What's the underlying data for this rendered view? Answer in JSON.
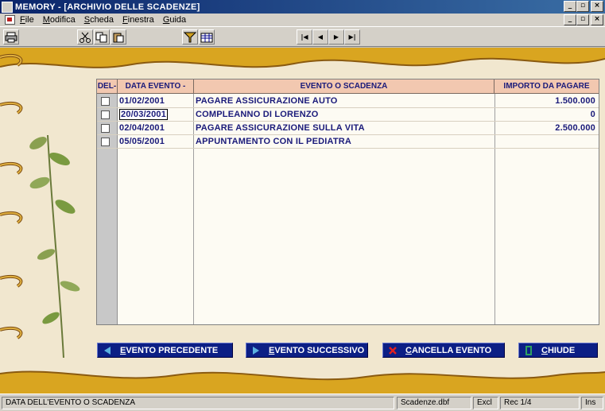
{
  "window": {
    "title": "MEMORY - [ARCHIVIO DELLE SCADENZE]"
  },
  "menu": {
    "items": [
      "File",
      "Modifica",
      "Scheda",
      "Finestra",
      "Guida"
    ]
  },
  "toolbar": {
    "icons": [
      "printer-icon",
      "scissors-icon",
      "copy-icon",
      "paste-icon",
      "filter-icon",
      "table-icon"
    ],
    "nav": [
      "|◀",
      "◀",
      "▶",
      "▶|"
    ]
  },
  "grid": {
    "headers": {
      "del": "DEL-",
      "date": "DATA EVENTO -",
      "event": "EVENTO O SCADENZA",
      "amount": "IMPORTO DA PAGARE"
    },
    "rows": [
      {
        "date": "01/02/2001",
        "event": "PAGARE ASSICURAZIONE AUTO",
        "amount": "1.500.000"
      },
      {
        "date": "20/03/2001",
        "event": "COMPLEANNO DI LORENZO",
        "amount": "0"
      },
      {
        "date": "02/04/2001",
        "event": "PAGARE ASSICURAZIONE SULLA VITA",
        "amount": "2.500.000"
      },
      {
        "date": "05/05/2001",
        "event": "APPUNTAMENTO CON IL PEDIATRA",
        "amount": ""
      }
    ]
  },
  "buttons": {
    "prev": "EVENTO PRECEDENTE",
    "next": "EVENTO SUCCESSIVO",
    "delete": "CANCELLA EVENTO",
    "close": "CHIUDE"
  },
  "status": {
    "message": "DATA DELL'EVENTO O SCADENZA",
    "file": "Scadenze.dbf",
    "mode": "Excl",
    "record": "Rec 1/4",
    "ins": "Ins"
  },
  "colors": {
    "title_bar": "#0a246a",
    "button_bg": "#0c1f85",
    "header_bg": "#f2c8b0",
    "text_blue": "#1a1a7a",
    "wave_gold": "#d9a520"
  }
}
